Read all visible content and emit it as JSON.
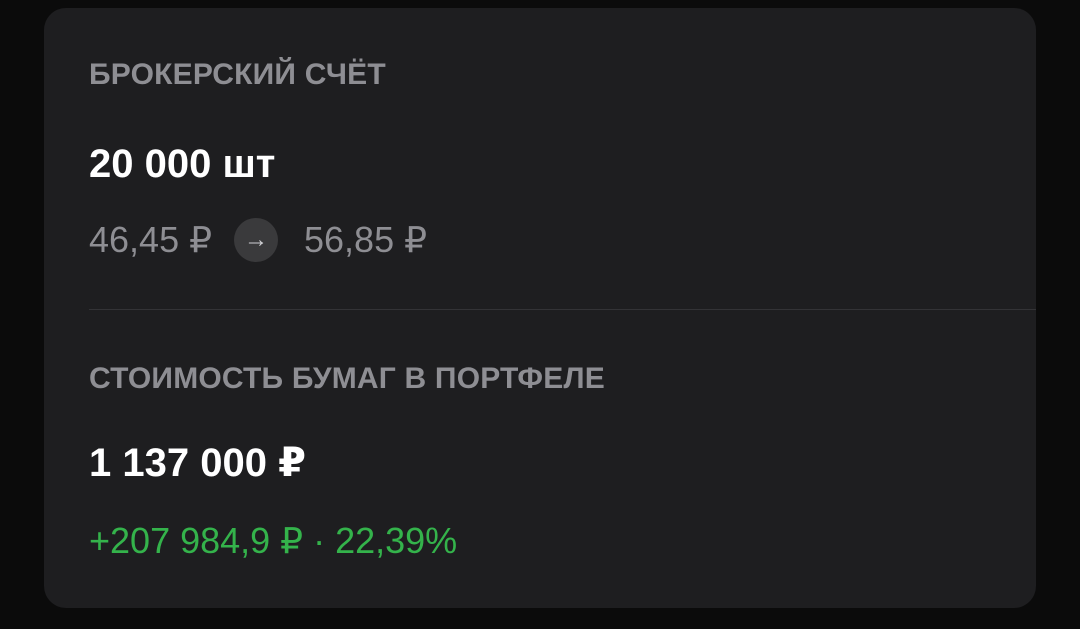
{
  "brokerage": {
    "title": "БРОКЕРСКИЙ СЧЁТ",
    "quantity": "20 000 шт",
    "price_from": "46,45 ₽",
    "price_to": "56,85 ₽",
    "arrow_icon": "→"
  },
  "portfolio": {
    "title": "СТОИМОСТЬ БУМАГ В ПОРТФЕЛЕ",
    "value": "1 137 000 ₽",
    "gain": "+207 984,9 ₽ · 22,39%"
  },
  "colors": {
    "background": "#0b0b0b",
    "card": "#1e1e20",
    "secondary_text": "#8e8e93",
    "primary_text": "#ffffff",
    "gain": "#34b34b"
  }
}
